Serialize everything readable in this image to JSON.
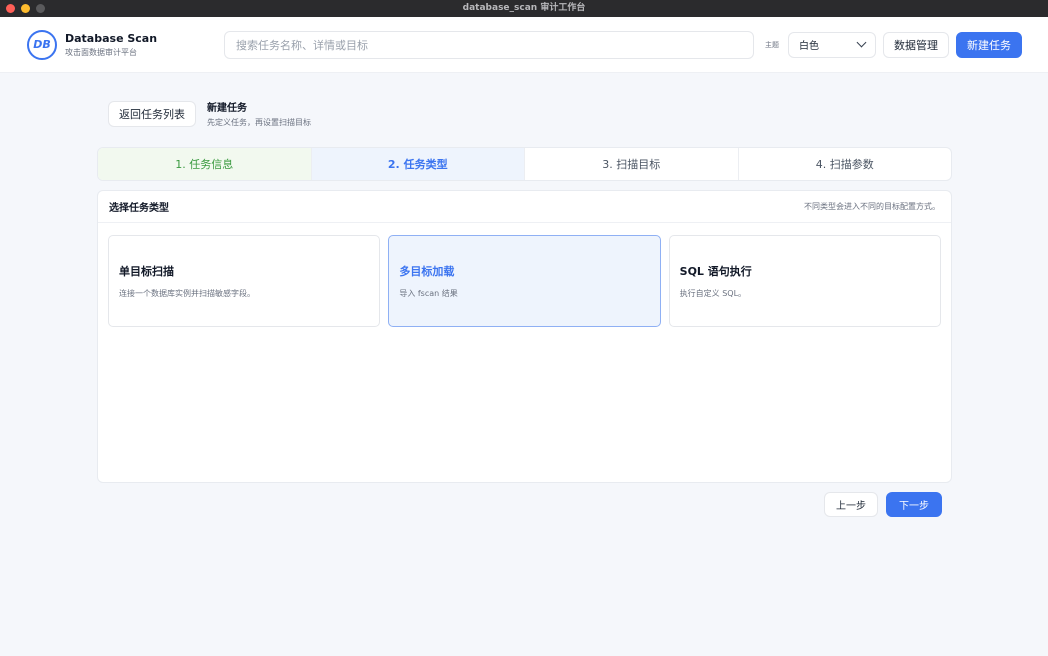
{
  "window": {
    "title": "database_scan 审计工作台"
  },
  "header": {
    "logo_badge": "DB",
    "app_name": "Database Scan",
    "app_sub": "攻击面数据审计平台",
    "search_placeholder": "搜索任务名称、详情或目标",
    "theme_label": "主题",
    "theme_value": "白色",
    "data_manage": "数据管理",
    "new_task": "新建任务"
  },
  "crumb": {
    "back": "返回任务列表",
    "title": "新建任务",
    "sub": "先定义任务，再设置扫描目标"
  },
  "steps": [
    {
      "label": "1. 任务信息"
    },
    {
      "label": "2. 任务类型"
    },
    {
      "label": "3. 扫描目标"
    },
    {
      "label": "4. 扫描参数"
    }
  ],
  "panel": {
    "title": "选择任务类型",
    "hint": "不同类型会进入不同的目标配置方式。",
    "options": [
      {
        "title": "单目标扫描",
        "desc": "连接一个数据库实例并扫描敏感字段。"
      },
      {
        "title": "多目标加载",
        "desc": "导入 fscan 结果"
      },
      {
        "title": "SQL 语句执行",
        "desc": "执行自定义 SQL。"
      }
    ]
  },
  "footer": {
    "prev": "上一步",
    "next": "下一步"
  },
  "colors": {
    "accent": "#3b74f0",
    "done_green": "#3a9a3f"
  }
}
